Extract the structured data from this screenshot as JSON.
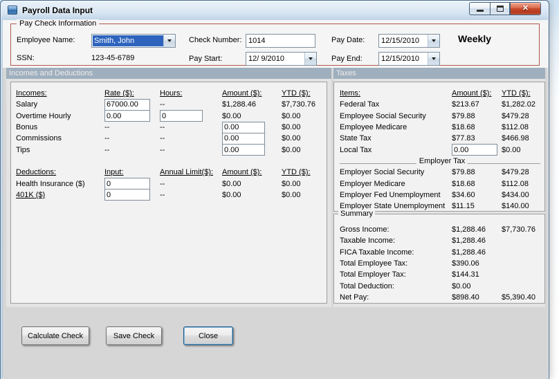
{
  "window": {
    "title": "Payroll Data Input",
    "close_glyph": "✕"
  },
  "pay_check_info": {
    "legend": "Pay Check Information",
    "employee_name_label": "Employee Name:",
    "employee_name": "Smith, John",
    "ssn_label": "SSN:",
    "ssn": "123-45-6789",
    "check_number_label": "Check Number:",
    "check_number": "1014",
    "pay_start_label": "Pay Start:",
    "pay_start": "12/ 9/2010",
    "pay_date_label": "Pay Date:",
    "pay_date": "12/15/2010",
    "pay_end_label": "Pay End:",
    "pay_end": "12/15/2010",
    "frequency": "Weekly"
  },
  "incomes_section": {
    "header": "Incomes and Deductions",
    "income_headers": [
      "Incomes:",
      "Rate ($):",
      "Hours:",
      "Amount ($):",
      "YTD ($):"
    ],
    "incomes": [
      {
        "label": "Salary",
        "rate": "67000.00",
        "hours": "--",
        "amount": "$1,288.46",
        "ytd": "$7,730.76"
      },
      {
        "label": "Overtime Hourly",
        "rate": "0.00",
        "hours": "0",
        "amount": "$0.00",
        "ytd": "$0.00"
      },
      {
        "label": "Bonus",
        "rate": "--",
        "hours": "--",
        "amount": "0.00",
        "ytd": "$0.00"
      },
      {
        "label": "Commissions",
        "rate": "--",
        "hours": "--",
        "amount": "0.00",
        "ytd": "$0.00"
      },
      {
        "label": "Tips",
        "rate": "--",
        "hours": "--",
        "amount": "0.00",
        "ytd": "$0.00"
      }
    ],
    "deduction_headers": [
      "Deductions:",
      "Input:",
      "Annual Limit($):",
      "Amount ($):",
      "YTD ($):"
    ],
    "deductions": [
      {
        "label": "Health Insurance ($)",
        "input": "0",
        "annual_limit": "--",
        "amount": "$0.00",
        "ytd": "$0.00"
      },
      {
        "label": "401K ($)",
        "input": "0",
        "annual_limit": "--",
        "amount": "$0.00",
        "ytd": "$0.00"
      }
    ]
  },
  "taxes_section": {
    "header": "Taxes",
    "col_headers": [
      "Items:",
      "Amount ($):",
      "YTD ($):"
    ],
    "employee_taxes": [
      {
        "label": "Federal Tax",
        "amount": "$213.67",
        "ytd": "$1,282.02"
      },
      {
        "label": "Employee Social Security",
        "amount": "$79.88",
        "ytd": "$479.28"
      },
      {
        "label": "Employee Medicare",
        "amount": "$18.68",
        "ytd": "$112.08"
      },
      {
        "label": "State Tax",
        "amount": "$77.83",
        "ytd": "$466.98"
      },
      {
        "label": "Local Tax",
        "amount": "0.00",
        "ytd": "$0.00"
      }
    ],
    "employer_header": "Employer Tax",
    "employer_taxes": [
      {
        "label": "Employer Social Security",
        "amount": "$79.88",
        "ytd": "$479.28"
      },
      {
        "label": "Employer Medicare",
        "amount": "$18.68",
        "ytd": "$112.08"
      },
      {
        "label": "Employer Fed Unemployment",
        "amount": "$34.60",
        "ytd": "$434.00"
      },
      {
        "label": "Employer State Unemployment",
        "amount": "$11.15",
        "ytd": "$140.00"
      }
    ]
  },
  "summary": {
    "legend": "Summary",
    "rows": [
      {
        "label": "Gross Income:",
        "amount": "$1,288.46",
        "ytd": "$7,730.76"
      },
      {
        "label": "Taxable Income:",
        "amount": "$1,288.46",
        "ytd": ""
      },
      {
        "label": "FICA Taxable Income:",
        "amount": "$1,288.46",
        "ytd": ""
      },
      {
        "label": "Total Employee Tax:",
        "amount": "$390.06",
        "ytd": ""
      },
      {
        "label": "Total Employer Tax:",
        "amount": "$144.31",
        "ytd": ""
      },
      {
        "label": "Total Deduction:",
        "amount": "$0.00",
        "ytd": ""
      },
      {
        "label": "Net Pay:",
        "amount": "$898.40",
        "ytd": "$5,390.40"
      }
    ]
  },
  "buttons": {
    "calculate": "Calculate Check",
    "save": "Save Check",
    "close": "Close"
  }
}
